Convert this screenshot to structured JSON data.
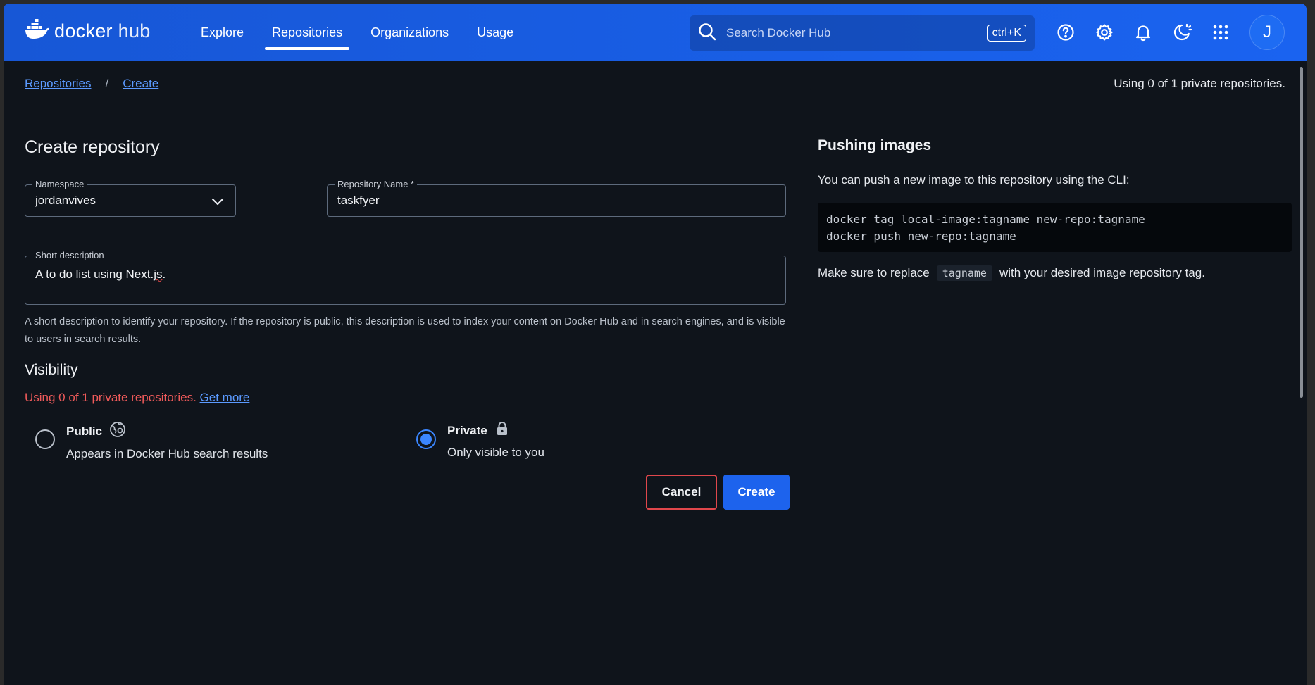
{
  "header": {
    "logo_docker": "docker",
    "logo_hub": "hub",
    "nav": [
      {
        "label": "Explore"
      },
      {
        "label": "Repositories"
      },
      {
        "label": "Organizations"
      },
      {
        "label": "Usage"
      }
    ],
    "active_nav": "Repositories",
    "search_placeholder": "Search Docker Hub",
    "search_shortcut": "ctrl+K",
    "icons": [
      "help-icon",
      "gear-icon",
      "bell-icon",
      "theme-icon",
      "apps-grid-icon"
    ],
    "avatar_initial": "J",
    "brand_color": "#1a63f0"
  },
  "breadcrumb": {
    "items": [
      "Repositories",
      "Create"
    ],
    "separator": "/"
  },
  "usage_top": "Using 0 of 1 private repositories.",
  "form": {
    "title": "Create repository",
    "namespace_label": "Namespace",
    "namespace_value": "jordanvives",
    "repo_name_label": "Repository Name *",
    "repo_name_value": "taskfyer",
    "short_desc_label": "Short description",
    "short_desc_value_prefix": "A to do list using Next.",
    "short_desc_value_spell": "js",
    "short_desc_value_suffix": ".",
    "helper_text": "A short description to identify your repository. If the repository is public, this description is used to index your content on Docker Hub and in search engines, and is visible to users in search results.",
    "visibility_title": "Visibility",
    "visibility_usage": "Using 0 of 1 private repositories.",
    "get_more": "Get more",
    "options": [
      {
        "title": "Public",
        "desc": "Appears in Docker Hub search results",
        "icon": "globe-icon",
        "checked": false
      },
      {
        "title": "Private",
        "desc": "Only visible to you",
        "icon": "lock-icon",
        "checked": true
      }
    ],
    "cancel_label": "Cancel",
    "create_label": "Create"
  },
  "pushing": {
    "title": "Pushing images",
    "desc": "You can push a new image to this repository using the CLI:",
    "code_lines": [
      "docker tag local-image:tagname new-repo:tagname",
      "docker push new-repo:tagname"
    ],
    "note_before": "Make sure to replace",
    "note_code": "tagname",
    "note_after": "with your desired image repository tag."
  }
}
